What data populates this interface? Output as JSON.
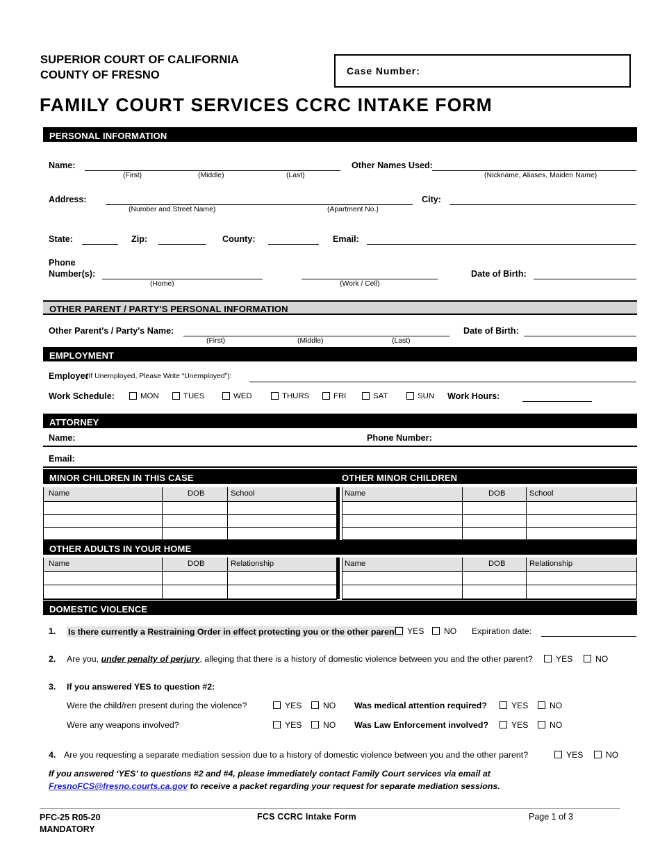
{
  "header": {
    "court_line1": "SUPERIOR COURT OF CALIFORNIA",
    "court_line2": "COUNTY OF FRESNO",
    "case_number_label": "Case Number:",
    "form_title": "FAMILY COURT SERVICES CCRC INTAKE FORM"
  },
  "sections": {
    "personal": "PERSONAL INFORMATION",
    "other_parent": "OTHER PARENT / PARTY'S PERSONAL INFORMATION",
    "employment": "EMPLOYMENT",
    "attorney": "ATTORNEY",
    "minor_children": "MINOR CHILDREN IN THIS CASE",
    "other_minor_children": "OTHER MINOR CHILDREN",
    "other_adults": "OTHER ADULTS IN YOUR HOME",
    "domestic_violence": "DOMESTIC VIOLENCE"
  },
  "personal": {
    "name_label": "Name:",
    "name_first": "(First)",
    "name_middle": "(Middle)",
    "name_last": "(Last)",
    "other_names_label": "Other Names Used:",
    "other_names_hint": "(Nickname, Aliases, Maiden Name)",
    "address_label": "Address:",
    "address_hint": "(Number and Street Name)",
    "apartment_hint": "(Apartment No.)",
    "city_label": "City:",
    "state_label": "State:",
    "zip_label": "Zip:",
    "county_label": "County:",
    "email_label": "Email:",
    "phone_label_1": "Phone",
    "phone_label_2": "Number(s):",
    "phone_home_hint": "(Home)",
    "phone_work_hint": "(Work / Cell)",
    "dob_label": "Date of Birth:"
  },
  "other_parent": {
    "name_label": "Other Parent's / Party's Name:",
    "name_first": "(First)",
    "name_middle": "(Middle)",
    "name_last": "(Last)",
    "dob_label": "Date of Birth:"
  },
  "employment": {
    "employer_label": "Employer",
    "employer_hint": "(If Unemployed, Please Write “Unemployed”):",
    "work_schedule_label": "Work Schedule:",
    "days": [
      "MON",
      "TUES",
      "WED",
      "THURS",
      "FRI",
      "SAT",
      "SUN"
    ],
    "work_hours_label": "Work Hours:"
  },
  "attorney": {
    "name_label": "Name:",
    "phone_label": "Phone Number:",
    "email_label": "Email:"
  },
  "tables": {
    "children_headers": [
      "Name",
      "DOB",
      "School"
    ],
    "adults_headers": [
      "Name",
      "DOB",
      "Relationship"
    ],
    "children_rows": 3,
    "adults_rows": 2
  },
  "dv": {
    "q1_num": "1.",
    "q1_text": "Is there currently a Restraining Order in effect protecting you or the other parent?",
    "q1_expiration_label": "Expiration date:",
    "q2_num": "2.",
    "q2_a": "Are you, ",
    "q2_b": "under penalty of perjury",
    "q2_c": ", alleging that there is a history of domestic violence between you and the other parent?",
    "q3_num": "3.",
    "q3_text": "If you answered YES to question #2:",
    "q3_sub": [
      "Were the child/ren present during the violence?",
      "Was medical attention required?",
      "Were any weapons involved?",
      "Was Law Enforcement involved?"
    ],
    "q4_num": "4.",
    "q4_text": "Are you requesting a separate mediation session due to a history of domestic violence between you and the other parent?",
    "yes": "YES",
    "no": "NO",
    "note_line1": "If you answered ‘YES’ to questions #2 and #4, please immediately contact Family Court services via email at",
    "note_email": "FresnoFCS@fresno.courts.ca.gov",
    "note_line2": " to receive a packet regarding your request for separate mediation sessions."
  },
  "footer": {
    "form_code": "PFC-25  R05-20",
    "mandatory": "MANDATORY",
    "center": "FCS CCRC Intake Form",
    "page": "Page 1 of 3"
  },
  "colors": {
    "bar_black": "#000000",
    "bar_gray": "#d4d4d4",
    "table_header": "#e2e2e2",
    "link": "#2020d0"
  }
}
